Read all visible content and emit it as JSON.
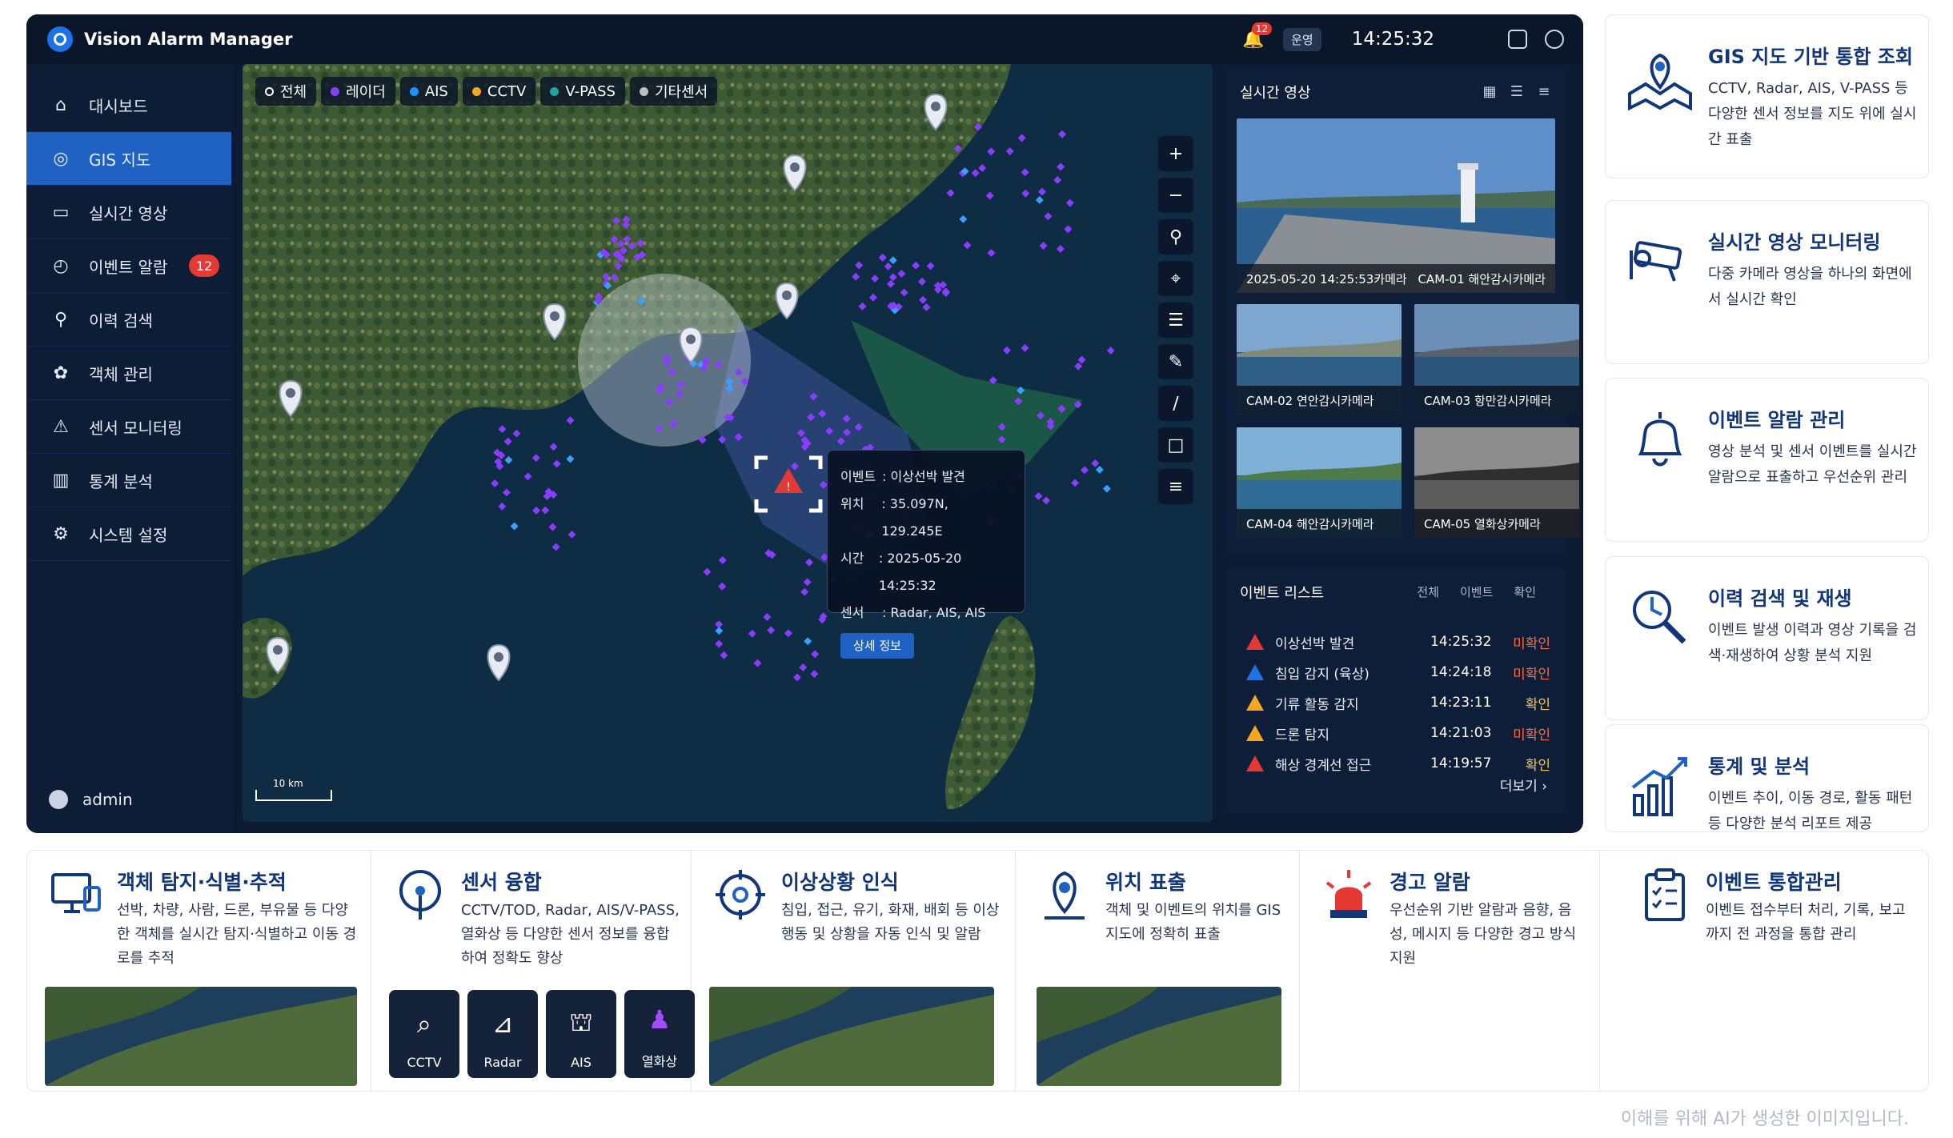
{
  "app": {
    "title": "Vision Alarm Manager",
    "notif_count": "12",
    "mode_label": "운영",
    "clock": "14:25:32"
  },
  "sidebar": {
    "items": [
      {
        "label": "대시보드",
        "icon": "home-icon"
      },
      {
        "label": "GIS 지도",
        "icon": "map-pin-icon",
        "active": true
      },
      {
        "label": "실시간 영상",
        "icon": "video-icon"
      },
      {
        "label": "이벤트 알람",
        "icon": "alarm-icon",
        "badge": "12"
      },
      {
        "label": "이력 검색",
        "icon": "search-icon"
      },
      {
        "label": "객체 관리",
        "icon": "objects-icon"
      },
      {
        "label": "센서 모니터링",
        "icon": "sensor-icon"
      },
      {
        "label": "통계 분석",
        "icon": "chart-icon"
      },
      {
        "label": "시스템 설정",
        "icon": "gear-icon"
      }
    ],
    "user": "admin"
  },
  "map": {
    "layers": [
      {
        "label": "전체",
        "color": ""
      },
      {
        "label": "레이더",
        "color": "#8b3dff"
      },
      {
        "label": "AIS",
        "color": "#1e90ff"
      },
      {
        "label": "CCTV",
        "color": "#f5a623"
      },
      {
        "label": "V-PASS",
        "color": "#19a8a0"
      },
      {
        "label": "기타센서",
        "color": "#bdbdbd"
      }
    ],
    "scale": "10 km",
    "popup": {
      "event_key": "이벤트",
      "event_val": ": 이상선박 발견",
      "pos_key": "위치",
      "pos_val": ": 35.097N, 129.245E",
      "time_key": "시간",
      "time_val": ": 2025-05-20 14:25:32",
      "sensor_key": "센서",
      "sensor_val": ": Radar, AIS, AIS",
      "button": "상세 정보"
    }
  },
  "video": {
    "title": "실시간 영상",
    "main": {
      "time": "2025-05-20 14:25:53카메라",
      "name": "CAM-01 해안감시카메라"
    },
    "cams": [
      {
        "name": "CAM-02 연안감시카메라"
      },
      {
        "name": "CAM-03 항만감시카메라"
      },
      {
        "name": "CAM-04 해안감시카메라"
      },
      {
        "name": "CAM-05 열화상카메라"
      }
    ]
  },
  "events": {
    "title": "이벤트 리스트",
    "tabs": [
      "전체",
      "이벤트",
      "확인"
    ],
    "rows": [
      {
        "name": "이상선박 발견",
        "time": "14:25:32",
        "status": "미확인",
        "color": "#e53935"
      },
      {
        "name": "침입 감지 (육상)",
        "time": "14:24:18",
        "status": "미확인",
        "color": "#1e72e8"
      },
      {
        "name": "기류 활동 감지",
        "time": "14:23:11",
        "status": "확인",
        "color": "#f5a623"
      },
      {
        "name": "드론 탐지",
        "time": "14:21:03",
        "status": "미확인",
        "color": "#f5a623"
      },
      {
        "name": "해상 경계선 접근",
        "time": "14:19:57",
        "status": "확인",
        "color": "#e53935"
      }
    ],
    "more": "더보기 ›"
  },
  "features_right": [
    {
      "title": "GIS 지도 기반 통합 조회",
      "desc": "CCTV, Radar, AIS, V-PASS 등 다양한 센서 정보를 지도 위에 실시간 표출",
      "icon": "map-icon"
    },
    {
      "title": "실시간 영상 모니터링",
      "desc": "다중 카메라 영상을 하나의 화면에서 실시간 확인",
      "icon": "cctv-icon"
    },
    {
      "title": "이벤트 알람 관리",
      "desc": "영상 분석 및 센서 이벤트를 실시간 알람으로 표출하고 우선순위 관리",
      "icon": "bell-icon"
    },
    {
      "title": "이력 검색 및 재생",
      "desc": "이벤트 발생 이력과 영상 기록을 검색·재생하여 상황 분석 지원",
      "icon": "history-search-icon"
    },
    {
      "title": "통계 및 분석",
      "desc": "이벤트 추이, 이동 경로, 활동 패턴 등 다양한 분석 리포트 제공",
      "icon": "chart-growth-icon"
    }
  ],
  "features_bottom": [
    {
      "title": "객체 탐지·식별·추적",
      "desc": "선박, 차량, 사람, 드론, 부유물 등 다양한 객체를 실시간 탐지·식별하고 이동 경로를 추적",
      "icon": "monitor-icon"
    },
    {
      "title": "센서 융합",
      "desc": "CCTV/TOD, Radar, AIS/V-PASS, 열화상 등 다양한 센서 정보를 융합하여 정확도 향상",
      "icon": "sensor-fusion-icon",
      "sensors": [
        "CCTV",
        "Radar",
        "AIS",
        "열화상"
      ]
    },
    {
      "title": "이상상황 인식",
      "desc": "침입, 접근, 유기, 화재, 배회 등 이상 행동 및 상황을 자동 인식 및 알람",
      "icon": "target-icon"
    },
    {
      "title": "위치 표출",
      "desc": "객체 및 이벤트의 위치를 GIS 지도에 정확히 표출",
      "icon": "location-icon"
    },
    {
      "title": "경고 알람",
      "desc": "우선순위 기반 알람과 음향, 음성, 메시지 등 다양한 경고 방식 지원",
      "icon": "siren-icon"
    },
    {
      "title": "이벤트 통합관리",
      "desc": "이벤트 접수부터 처리, 기록, 보고까지 전 과정을 통합 관리",
      "icon": "clipboard-icon"
    }
  ],
  "footnote": "이해를 위해 AI가 생성한 이미지입니다."
}
